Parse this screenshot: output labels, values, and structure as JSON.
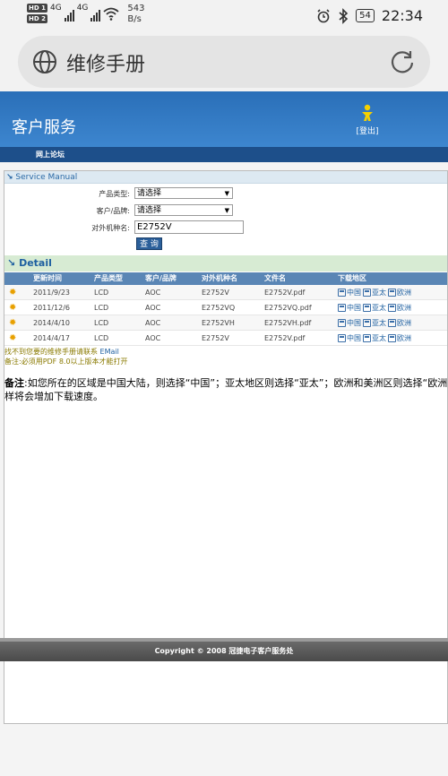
{
  "status_bar": {
    "sim1": "HD 1",
    "sim2": "HD 2",
    "net1": "4G",
    "net2": "4G",
    "speed_value": "543",
    "speed_unit": "B/s",
    "battery": "54",
    "time": "22:34"
  },
  "browser": {
    "title": "维修手册",
    "icons": {
      "left": "globe-icon",
      "right": "reload-icon"
    }
  },
  "header": {
    "title": "客户服务",
    "logout_label": "[登出]"
  },
  "nav": {
    "forum_label": "网上论坛"
  },
  "service_manual": {
    "section_title": "Service Manual",
    "product_type_label": "产品类型:",
    "product_type_value": "请选择",
    "brand_label": "客户/品牌:",
    "brand_value": "请选择",
    "model_label": "对外机种名:",
    "model_value": "E2752V",
    "query_button": "查 询"
  },
  "detail": {
    "section_title": "Detail",
    "columns": [
      "更新时间",
      "产品类型",
      "客户/品牌",
      "对外机种名",
      "文件名",
      "下载地区"
    ],
    "rows": [
      {
        "date": "2011/9/23",
        "type": "LCD",
        "brand": "AOC",
        "model": "E2752V",
        "file": "E2752V.pdf"
      },
      {
        "date": "2011/12/6",
        "type": "LCD",
        "brand": "AOC",
        "model": "E2752VQ",
        "file": "E2752VQ.pdf"
      },
      {
        "date": "2014/4/10",
        "type": "LCD",
        "brand": "AOC",
        "model": "E2752VH",
        "file": "E2752VH.pdf"
      },
      {
        "date": "2014/4/17",
        "type": "LCD",
        "brand": "AOC",
        "model": "E2752V",
        "file": "E2752V.pdf"
      }
    ],
    "regions": [
      "中国",
      "亚太",
      "欧洲"
    ]
  },
  "notes": {
    "contact_text": "找不到您要的维修手册请联系",
    "email_label": "EMail",
    "pdf_note": "备注:必须用PDF 8.0以上版本才能打开",
    "remark_label": "备注",
    "remark_line1": ":如您所在的区域是中国大陆，则选择“中国”；亚太地区则选择“亚太”；欧洲和美洲区则选择“欧洲",
    "remark_line2": "样将会增加下载速度。"
  },
  "footer": {
    "copyright": "Copyright © 2008 冠捷电子客户服务处"
  },
  "colors": {
    "banner": "#3479c2",
    "navbar": "#1d4f8a",
    "table_header": "#5a86b5",
    "link": "#1d5fa0"
  }
}
